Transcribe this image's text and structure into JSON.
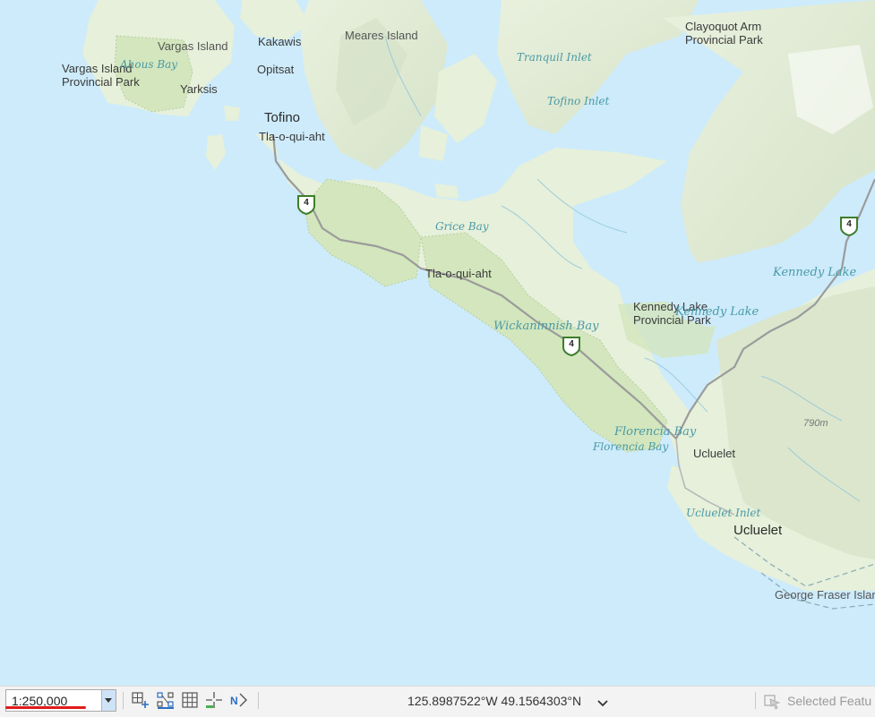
{
  "map": {
    "labels": {
      "vargas_island": "Vargas Island",
      "kakawis": "Kakawis",
      "meares_island": "Meares Island",
      "vargas_park": "Vargas Island\nProvincial Park",
      "ahous_bay": "Ahous Bay",
      "opitsat": "Opitsat",
      "yarksis": "Yarksis",
      "tranquil_inlet": "Tranquil Inlet",
      "clayoquot_park": "Clayoquot Arm\nProvincial Park",
      "tofino": "Tofino",
      "tofino_inlet": "Tofino Inlet",
      "tla_north": "Tla-o-qui-aht",
      "grice_bay": "Grice Bay",
      "tla_south": "Tla-o-qui-aht",
      "kennedy_lake_north": "Kennedy Lake",
      "kennedy_park": "Kennedy Lake\nProvincial Park",
      "kennedy_lake_south": "Kennedy Lake",
      "wickaninnish_bay": "Wickaninnish Bay",
      "elevation": "790m",
      "florencia_bay_1": "Florencia Bay",
      "florencia_bay_2": "Florencia Bay",
      "ucluelet_small": "Ucluelet",
      "ucluelet_inlet": "Ucluelet Inlet",
      "ucluelet": "Ucluelet",
      "george_fraser": "George Fraser Islan"
    },
    "highway_number": "4",
    "colors": {
      "water": "#cdebfb",
      "land": "#e6f0da",
      "park": "#d3e6bd",
      "road": "#9b9b9b",
      "shield_border": "#3d7d2b"
    }
  },
  "statusbar": {
    "scale_value": "1:250,000",
    "coordinates": "125.8987522°W 49.1564303°N",
    "selected_features_label": "Selected Featu",
    "tools": [
      "zoom-to-layer-icon",
      "snapping-icon",
      "grid-icon",
      "cursor-crosshair-icon",
      "north-arrow-icon"
    ]
  }
}
